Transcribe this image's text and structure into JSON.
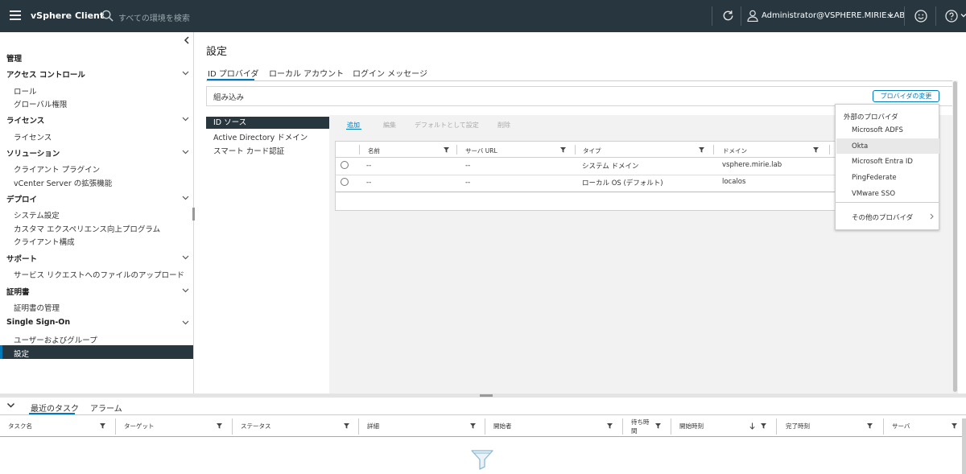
{
  "header": {
    "app_name": "vSphere Client",
    "search_placeholder": "すべての環境を検索",
    "user": "Administrator@VSPHERE.MIRIE.LAB"
  },
  "sidebar": {
    "root": "管理",
    "sections": [
      {
        "title": "アクセス コントロール",
        "items": [
          "ロール",
          "グローバル権限"
        ]
      },
      {
        "title": "ライセンス",
        "items": [
          "ライセンス"
        ]
      },
      {
        "title": "ソリューション",
        "items": [
          "クライアント プラグイン",
          "vCenter Server の拡張機能"
        ]
      },
      {
        "title": "デプロイ",
        "items": [
          "システム設定",
          "カスタマ エクスペリエンス向上プログラム",
          "クライアント構成"
        ]
      },
      {
        "title": "サポート",
        "items": [
          "サービス リクエストへのファイルのアップロード"
        ]
      },
      {
        "title": "証明書",
        "items": [
          "証明書の管理"
        ]
      },
      {
        "title": "Single Sign-On",
        "items": [
          "ユーザーおよびグループ",
          "設定"
        ]
      }
    ],
    "selected": "設定"
  },
  "main": {
    "title": "設定",
    "tabs": [
      "ID プロバイダ",
      "ローカル アカウント",
      "ログイン メッセージ"
    ],
    "active_tab": "ID プロバイダ",
    "builtin_label": "組み込み",
    "change_provider_button": "プロバイダの変更",
    "left_nav": [
      "ID ソース",
      "Active Directory ドメイン",
      "スマート カード認証"
    ],
    "left_nav_selected": "ID ソース",
    "actions": {
      "add": "追加",
      "edit": "編集",
      "set_default": "デフォルトとして設定",
      "delete": "削除"
    },
    "grid": {
      "columns": [
        "名前",
        "サーバ URL",
        "タイプ",
        "ドメイン"
      ],
      "rows": [
        {
          "name": "--",
          "server_url": "--",
          "type": "システム ドメイン",
          "domain": "vsphere.mirie.lab"
        },
        {
          "name": "--",
          "server_url": "--",
          "type": "ローカル OS (デフォルト)",
          "domain": "localos"
        }
      ]
    }
  },
  "dropdown": {
    "header": "外部のプロバイダ",
    "items": [
      "Microsoft ADFS",
      "Okta",
      "Microsoft Entra ID",
      "PingFederate",
      "VMware SSO"
    ],
    "highlighted": "Okta",
    "more": "その他のプロバイダ"
  },
  "bottom": {
    "tabs": [
      "最近のタスク",
      "アラーム"
    ],
    "active_tab": "最近のタスク",
    "columns": {
      "task": "タスク名",
      "target": "ターゲット",
      "status": "ステータス",
      "details": "詳細",
      "initiator": "開始者",
      "queued": "待ち時間",
      "start": "開始時刻",
      "complete": "完了時刻",
      "server": "サーバ"
    }
  },
  "colors": {
    "header_bg": "#28373f",
    "accent": "#0079b8",
    "selected_bg": "#28373f"
  }
}
